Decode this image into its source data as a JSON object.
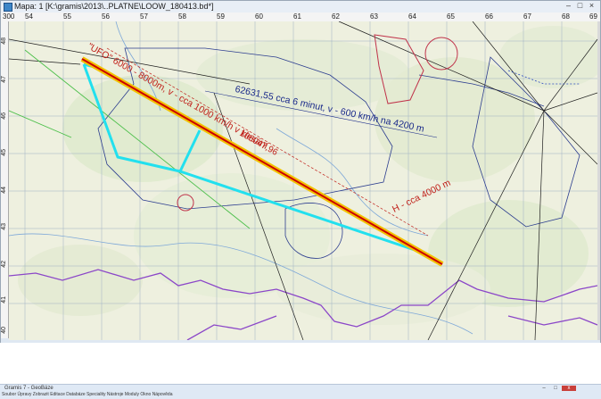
{
  "window": {
    "title": "Mapa: 1 [K:\\gramis\\2013\\..PLATNE\\LOOW_180413.bd*]",
    "controls": [
      "–",
      "□",
      "×"
    ]
  },
  "ruler": {
    "zoom": "300",
    "x_ticks": [
      "54",
      "55",
      "56",
      "57",
      "58",
      "59",
      "60",
      "61",
      "62",
      "63",
      "64",
      "65",
      "66",
      "67",
      "68",
      "69"
    ],
    "y_ticks": [
      "48",
      "47",
      "46",
      "45",
      "44",
      "43",
      "42",
      "41",
      "40"
    ]
  },
  "map": {
    "annotations": {
      "ufo": "\"UFO\" 6000 - 8000m, v - cca 1000 km/h v klesání",
      "distance1": "62631,55  cca 6 minut, v - 600 km/h na 4200 m",
      "distance2": "106047,96",
      "height": "H - cca 4000 m"
    },
    "colors": {
      "ufo_track": "#cc0000",
      "ufo_glow": "#f2c200",
      "route": "#22e0ee",
      "distance_text": "#1a2a8a",
      "annotation_red": "#c0201a"
    }
  },
  "second_window": {
    "title": "Gramis 7 - GeoBáze",
    "menu": "Soubor  Úpravy  Zobrazit  Editace  Databáze  Speciality  Nástroje  Moduly  Okno  Nápověda",
    "controls": [
      "–",
      "□",
      "x"
    ]
  }
}
